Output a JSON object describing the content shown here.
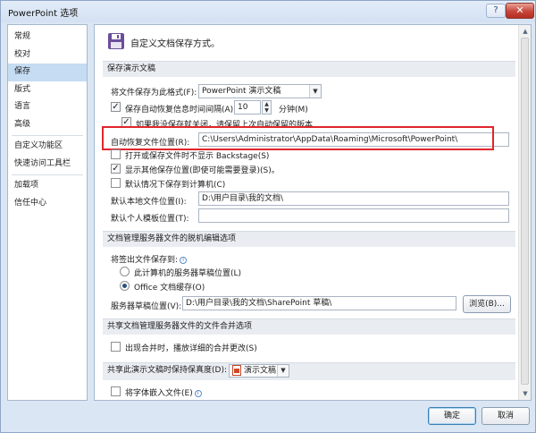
{
  "window": {
    "title": "PowerPoint 选项",
    "help_label": "?",
    "close_label": "✕"
  },
  "sidebar": {
    "items": [
      {
        "label": "常规"
      },
      {
        "label": "校对"
      },
      {
        "label": "保存"
      },
      {
        "label": "版式"
      },
      {
        "label": "语言"
      },
      {
        "label": "高级"
      },
      {
        "label": "自定义功能区"
      },
      {
        "label": "快速访问工具栏"
      },
      {
        "label": "加载项"
      },
      {
        "label": "信任中心"
      }
    ],
    "active_item": "保存"
  },
  "header": {
    "icon": "save-icon",
    "text": "自定义文档保存方式。"
  },
  "save_presentations": {
    "section_title": "保存演示文稿",
    "format_label": "将文件保存为此格式(F):",
    "format_value": "PowerPoint 演示文稿",
    "autorecover_label": "保存自动恢复信息时间间隔(A)",
    "autorecover_checked": true,
    "autorecover_minutes": "10",
    "minutes_label": "分钟(M)",
    "keep_last_label": "如果我没保存就关闭，请保留上次自动保留的版本",
    "keep_last_checked": true,
    "autorecover_location_label": "自动恢复文件位置(R):",
    "autorecover_location": "C:\\Users\\Administrator\\AppData\\Roaming\\Microsoft\\PowerPoint\\",
    "no_backstage_label": "打开或保存文件时不显示 Backstage(S)",
    "no_backstage_checked": false,
    "show_additional_label": "显示其他保存位置(即使可能需要登录)(S)。",
    "show_additional_checked": true,
    "save_local_label": "默认情况下保存到计算机(C)",
    "save_local_checked": false,
    "default_local_label": "默认本地文件位置(I):",
    "default_local_value": "D:\\用户目录\\我的文档\\",
    "default_template_label": "默认个人模板位置(T):",
    "default_template_value": ""
  },
  "offline_editing": {
    "section_title": "文档管理服务器文件的脱机编辑选项",
    "save_checked_out_label": "将签出文件保存到:",
    "option_server_drafts": "此计算机的服务器草稿位置(L)",
    "option_office_cache": "Office 文档缓存(O)",
    "selected": "office_cache",
    "drafts_location_label": "服务器草稿位置(V):",
    "drafts_location_value": "D:\\用户目录\\我的文档\\SharePoint 草稿\\",
    "browse_label": "浏览(B)..."
  },
  "merge": {
    "section_title": "共享文档管理服务器文件的文件合并选项",
    "show_merge_label": "出现合并时，播放详细的合并更改(S)",
    "show_merge_checked": false
  },
  "fidelity": {
    "section_title": "共享此演示文稿时保持保真度(D):",
    "document_value": "演示文稿1",
    "embed_fonts_label": "将字体嵌入文件(E)",
    "embed_fonts_checked": false
  },
  "footer": {
    "ok_label": "确定",
    "cancel_label": "取消"
  },
  "colors": {
    "accent": "#c5dcf3",
    "highlight_box": "#e0262b",
    "window_bg": "#dbe6f4"
  }
}
